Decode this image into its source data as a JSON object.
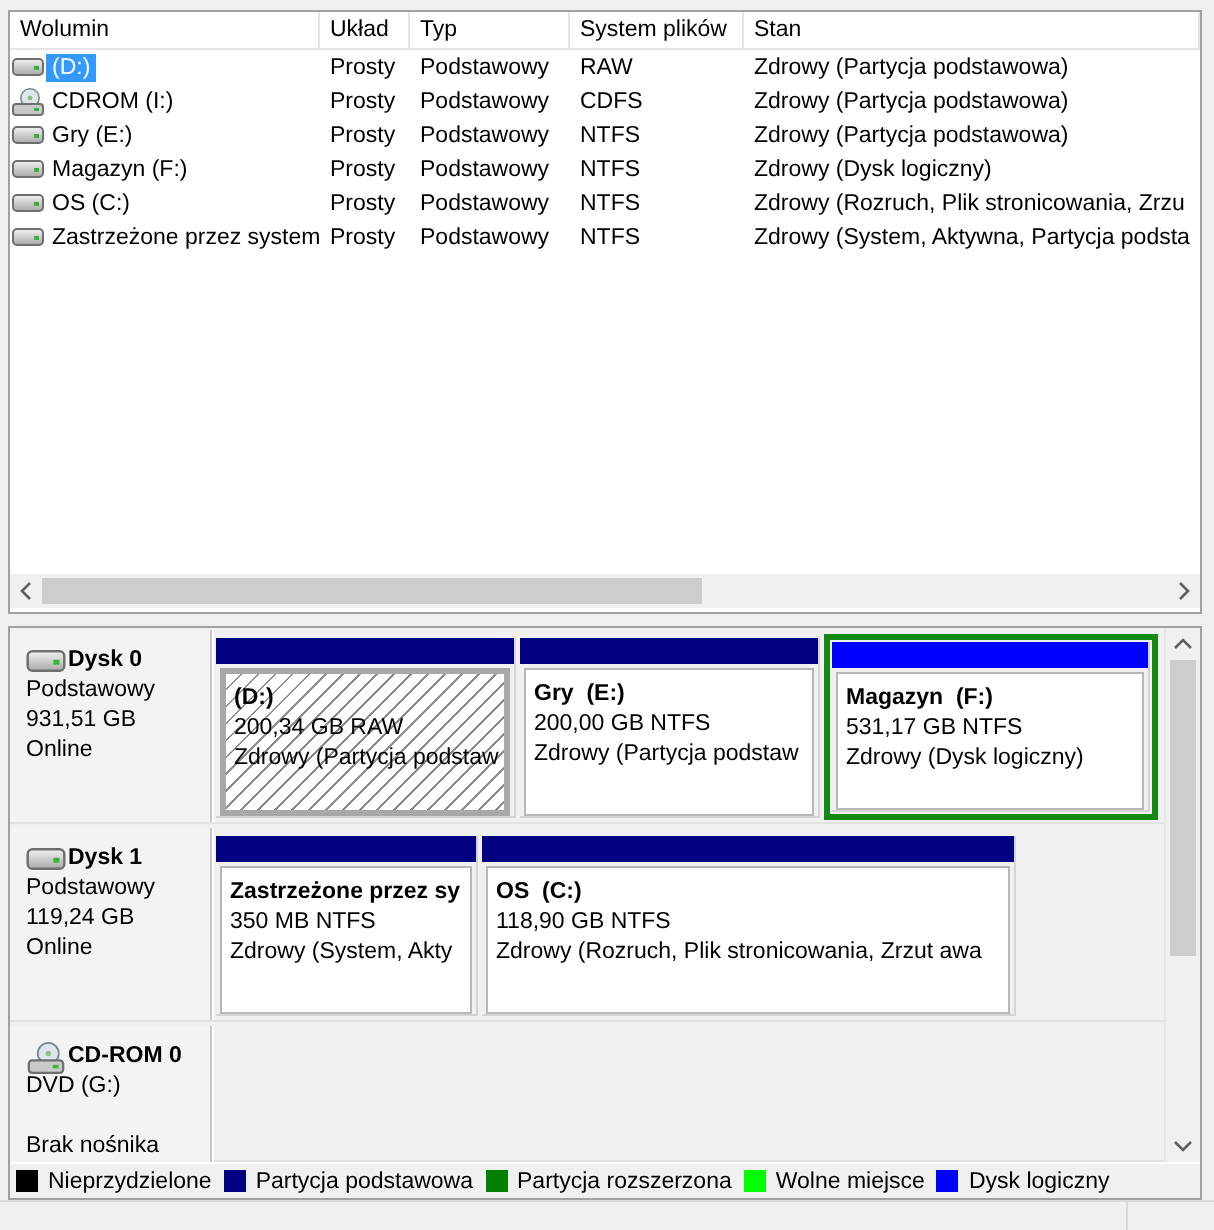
{
  "volume_list": {
    "columns": [
      "Wolumin",
      "Układ",
      "Typ",
      "System plików",
      "Stan"
    ],
    "rows": [
      {
        "kind": "disk",
        "selected": true,
        "cells": [
          "(D:)",
          "Prosty",
          "Podstawowy",
          "RAW",
          "Zdrowy (Partycja podstawowa)"
        ]
      },
      {
        "kind": "cdrom",
        "selected": false,
        "cells": [
          "CDROM (I:)",
          "Prosty",
          "Podstawowy",
          "CDFS",
          "Zdrowy (Partycja podstawowa)"
        ]
      },
      {
        "kind": "disk",
        "selected": false,
        "cells": [
          "Gry (E:)",
          "Prosty",
          "Podstawowy",
          "NTFS",
          "Zdrowy (Partycja podstawowa)"
        ]
      },
      {
        "kind": "disk",
        "selected": false,
        "cells": [
          "Magazyn (F:)",
          "Prosty",
          "Podstawowy",
          "NTFS",
          "Zdrowy (Dysk logiczny)"
        ]
      },
      {
        "kind": "disk",
        "selected": false,
        "cells": [
          "OS (C:)",
          "Prosty",
          "Podstawowy",
          "NTFS",
          "Zdrowy (Rozruch, Plik stronicowania, Zrzu"
        ]
      },
      {
        "kind": "disk",
        "selected": false,
        "cells": [
          "Zastrzeżone przez system",
          "Prosty",
          "Podstawowy",
          "NTFS",
          "Zdrowy (System, Aktywna, Partycja podsta"
        ]
      }
    ]
  },
  "disks": [
    {
      "kind": "disk",
      "name": "Dysk 0",
      "type": "Podstawowy",
      "size": "931,51 GB",
      "status": "Online",
      "partitions": [
        {
          "kind": "primary",
          "selected": true,
          "title": "(D:)",
          "size": "200,34 GB RAW",
          "status": "Zdrowy (Partycja podstaw"
        },
        {
          "kind": "primary",
          "selected": false,
          "title": "Gry  (E:)",
          "size": "200,00 GB NTFS",
          "status": "Zdrowy (Partycja podstaw"
        },
        {
          "kind": "logical",
          "selected": false,
          "title": "Magazyn  (F:)",
          "size": "531,17 GB NTFS",
          "status": "Zdrowy (Dysk logiczny)"
        }
      ]
    },
    {
      "kind": "disk",
      "name": "Dysk 1",
      "type": "Podstawowy",
      "size": "119,24 GB",
      "status": "Online",
      "partitions": [
        {
          "kind": "primary",
          "selected": false,
          "title": "Zastrzeżone przez sy",
          "size": "350 MB NTFS",
          "status": "Zdrowy (System, Akty"
        },
        {
          "kind": "primary",
          "selected": false,
          "title": "OS  (C:)",
          "size": "118,90 GB NTFS",
          "status": "Zdrowy (Rozruch, Plik stronicowania, Zrzut awa"
        }
      ]
    },
    {
      "kind": "cdrom",
      "name": "CD-ROM 0",
      "type": "DVD (G:)",
      "status": "Brak nośnika"
    }
  ],
  "legend": [
    {
      "label": "Nieprzydzielone",
      "color": "#000000"
    },
    {
      "label": "Partycja podstawowa",
      "color": "#000080"
    },
    {
      "label": "Partycja rozszerzona",
      "color": "#008000"
    },
    {
      "label": "Wolne miejsce",
      "color": "#00ff00"
    },
    {
      "label": "Dysk logiczny",
      "color": "#0000ff"
    }
  ]
}
